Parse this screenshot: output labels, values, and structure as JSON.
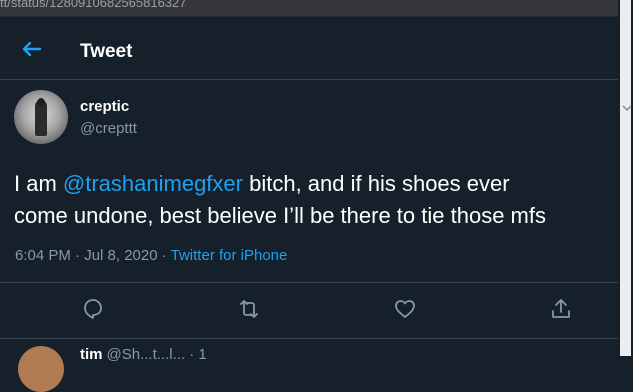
{
  "browser": {
    "url_fragment": "tt/status/1280910682565816327"
  },
  "header": {
    "title": "Tweet"
  },
  "tweet": {
    "display_name": "creptic",
    "handle": "@crepttt",
    "text_before": "I am ",
    "mention": "@trashanimegfxer",
    "text_line1_after": " bitch, and if his shoes ever",
    "text_line2": "come undone, best believe I’ll be there to tie those mfs",
    "timestamp": "6:04 PM · Jul 8, 2020 · ",
    "source": "Twitter for iPhone"
  },
  "actions": [
    "reply-icon",
    "retweet-icon",
    "like-icon",
    "share-icon"
  ],
  "next_tweet": {
    "display_name": "tim",
    "handle": "@Sh...t...l... · 1"
  },
  "colors": {
    "background": "#15202b",
    "accent": "#1da1f2",
    "muted": "#8899a6",
    "divider": "#38444d"
  }
}
